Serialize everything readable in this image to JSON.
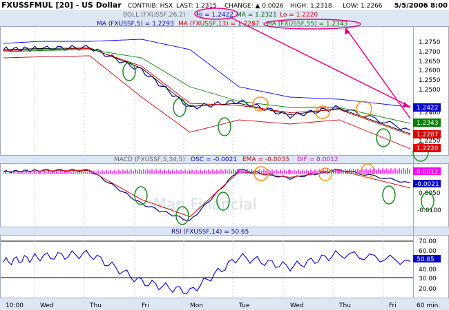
{
  "header": {
    "symbol": "FXUSSFMUL [20] - US Dollar",
    "contrib": "CONTRIB: HSX",
    "last": "LAST: 1.2315",
    "change": "CHANGE: ▲ 0.0026",
    "high": "HIGH: 1.2318",
    "low": "LOW: 1.2266",
    "datetime": "5/5/2006 8:00"
  },
  "legends": {
    "boll_prefix": "BOLL (FXUSSF,26,2)",
    "boll_hi": "Hi = 1.2422",
    "boll_ma": "MA = 1.2321",
    "boll_lo": "Lo = 1.2220",
    "ma5": "MA (FXUSSF,5) = 1.2293",
    "ma13": "MA (FXUSSF,13) = 1.2287",
    "ma55": "MA (FXUSSF,55) = 1.2343",
    "macd_prefix": "MACD (FXUSSF,5,34,5)",
    "macd_osc": "OSC = -0.0021",
    "macd_ema": "EMA = -0.0033",
    "macd_dif": "DIF = 0.0012",
    "rsi": "RSI (FXUSSF,14) = 50.65"
  },
  "value_tags": {
    "boll_hi": "1.2422",
    "ma55": "1.2343",
    "ma13": "1.2287",
    "boll_lo": "1.2220",
    "dif": "0.0012",
    "osc": "-0.0021",
    "rsi": "50.65"
  },
  "axis": {
    "price_ticks": [
      "1.2750",
      "1.2700",
      "1.2650",
      "1.2600",
      "1.2550",
      "1.2500",
      "1.2400",
      "1.2250"
    ],
    "macd_ticks": [
      "0.0050",
      "-0.0100"
    ],
    "rsi_ticks": [
      "70.00",
      "60.00",
      "40.00",
      "30.00",
      "20.00"
    ],
    "x_labels": [
      "10:00",
      "Wed",
      "Thu",
      "Fri",
      "Mon",
      "Tue",
      "Wed",
      "Thu",
      "Fri"
    ],
    "x_unit": "60 min."
  },
  "watermark": "Man Financial",
  "colors": {
    "price": "#00008b",
    "boll": "#0000ff",
    "ma5": "#000000",
    "ma13": "#cc0000",
    "ma55": "#008000",
    "histogram": "#ff00ff",
    "rsi": "#0000cc",
    "annotation": "#e6007e",
    "circle_green": "#1a8a1a",
    "circle_orange": "#ff8c1a",
    "tag_blue": "#0000cc",
    "tag_green": "#008000",
    "tag_red": "#dd0000",
    "tag_magenta": "#ff00ff"
  },
  "chart_data": [
    {
      "type": "line",
      "panel": "price",
      "x": [
        "10:00",
        "Wed",
        "Thu",
        "Fri",
        "Mon",
        "Tue",
        "Wed",
        "Thu",
        "Fri"
      ],
      "ylim": [
        1.22,
        1.28
      ],
      "series": [
        {
          "name": "FXUSSF",
          "values": [
            1.27,
            1.2705,
            1.271,
            1.26,
            1.242,
            1.245,
            1.238,
            1.242,
            1.231
          ]
        },
        {
          "name": "MA (FXUSSF,5)",
          "values": [
            1.27,
            1.2705,
            1.2708,
            1.261,
            1.2425,
            1.244,
            1.2385,
            1.2415,
            1.2293
          ]
        },
        {
          "name": "MA (FXUSSF,13)",
          "values": [
            1.2695,
            1.27,
            1.2705,
            1.262,
            1.244,
            1.243,
            1.2395,
            1.241,
            1.2287
          ]
        },
        {
          "name": "MA (FXUSSF,55)",
          "values": [
            1.269,
            1.2695,
            1.27,
            1.266,
            1.252,
            1.245,
            1.242,
            1.242,
            1.2343
          ]
        },
        {
          "name": "BOLL Hi",
          "values": [
            1.273,
            1.274,
            1.274,
            1.275,
            1.27,
            1.252,
            1.247,
            1.246,
            1.2422
          ]
        },
        {
          "name": "BOLL Lo",
          "values": [
            1.266,
            1.2665,
            1.267,
            1.247,
            1.23,
            1.236,
            1.234,
            1.236,
            1.222
          ]
        }
      ]
    },
    {
      "type": "line",
      "panel": "macd",
      "x": [
        "10:00",
        "Wed",
        "Thu",
        "Fri",
        "Mon",
        "Tue",
        "Wed",
        "Thu",
        "Fri"
      ],
      "ylim": [
        -0.012,
        0.002
      ],
      "series": [
        {
          "name": "OSC",
          "values": [
            0.0005,
            0.0008,
            0.0008,
            -0.007,
            -0.011,
            0.001,
            -0.001,
            0.001,
            -0.0021
          ]
        },
        {
          "name": "EMA",
          "values": [
            0.0005,
            0.0007,
            0.0008,
            -0.006,
            -0.01,
            0.0005,
            -0.0008,
            0.0008,
            -0.0033
          ]
        },
        {
          "name": "DIF",
          "values": [
            0.0003,
            0.0005,
            0.0006,
            0.001,
            0.0008,
            0.001,
            0.0008,
            0.001,
            0.0012
          ]
        }
      ]
    },
    {
      "type": "line",
      "panel": "rsi",
      "x": [
        "10:00",
        "Wed",
        "Thu",
        "Fri",
        "Mon",
        "Tue",
        "Wed",
        "Thu",
        "Fri"
      ],
      "ylim": [
        15,
        75
      ],
      "series": [
        {
          "name": "RSI (FXUSSF,14)",
          "values": [
            50,
            55,
            58,
            30,
            20,
            55,
            45,
            58,
            50.65
          ]
        }
      ]
    }
  ]
}
